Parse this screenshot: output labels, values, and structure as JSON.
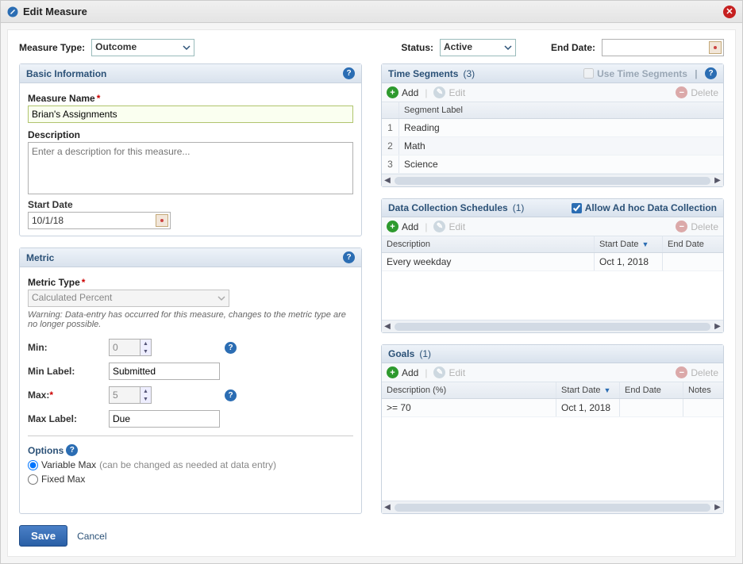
{
  "title": "Edit Measure",
  "top": {
    "measure_type_label": "Measure Type:",
    "measure_type_value": "Outcome",
    "status_label": "Status:",
    "status_value": "Active",
    "end_date_label": "End Date:",
    "end_date_value": ""
  },
  "basic_info": {
    "header": "Basic Information",
    "name_label": "Measure Name",
    "name_value": "Brian's Assignments",
    "desc_label": "Description",
    "desc_placeholder": "Enter a description for this measure...",
    "start_date_label": "Start Date",
    "start_date_value": "10/1/18"
  },
  "metric": {
    "header": "Metric",
    "type_label": "Metric Type",
    "type_value": "Calculated Percent",
    "warning": "Warning: Data-entry has occurred for this measure, changes to the metric type are no longer possible.",
    "min_label": "Min:",
    "min_value": "0",
    "min_label_label": "Min Label:",
    "min_label_value": "Submitted",
    "max_label": "Max:",
    "max_value": "5",
    "max_label_label": "Max Label:",
    "max_label_value": "Due",
    "options_title": "Options",
    "variable_max_label": "Variable Max",
    "variable_max_hint": "(can be changed as needed at data entry)",
    "fixed_max_label": "Fixed Max"
  },
  "time_segments": {
    "header": "Time Segments",
    "count": "(3)",
    "use_label": "Use Time Segments",
    "add_label": "Add",
    "edit_label": "Edit",
    "delete_label": "Delete",
    "col_label": "Segment Label",
    "rows": [
      {
        "idx": "1",
        "label": "Reading"
      },
      {
        "idx": "2",
        "label": "Math"
      },
      {
        "idx": "3",
        "label": "Science"
      }
    ]
  },
  "schedules": {
    "header": "Data Collection Schedules",
    "count": "(1)",
    "allow_label": "Allow Ad hoc Data Collection",
    "add_label": "Add",
    "edit_label": "Edit",
    "delete_label": "Delete",
    "cols": {
      "desc": "Description",
      "start": "Start Date",
      "end": "End Date"
    },
    "rows": [
      {
        "desc": "Every weekday",
        "start": "Oct 1, 2018",
        "end": ""
      }
    ]
  },
  "goals": {
    "header": "Goals",
    "count": "(1)",
    "add_label": "Add",
    "edit_label": "Edit",
    "delete_label": "Delete",
    "cols": {
      "desc": "Description (%)",
      "start": "Start Date",
      "end": "End Date",
      "notes": "Notes"
    },
    "rows": [
      {
        "desc": ">= 70",
        "start": "Oct 1, 2018",
        "end": "",
        "notes": ""
      }
    ]
  },
  "footer": {
    "save": "Save",
    "cancel": "Cancel"
  }
}
